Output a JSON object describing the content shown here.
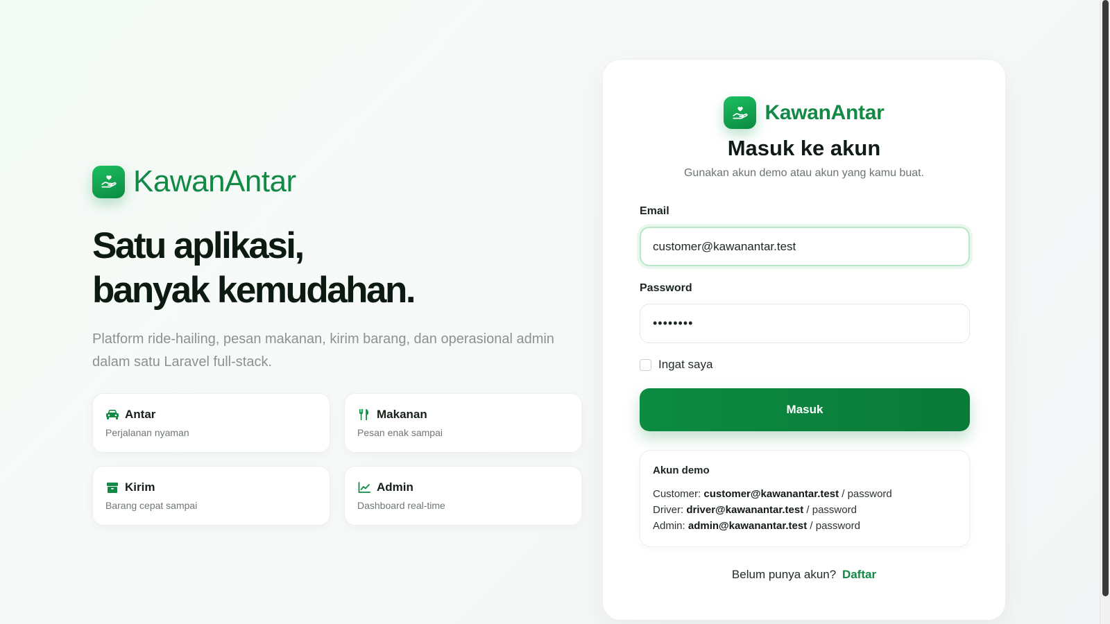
{
  "brand": {
    "name": "KawanAntar",
    "accent": "#128a46",
    "logo_icon": "hand-heart-icon"
  },
  "hero": {
    "headline_line1": "Satu aplikasi,",
    "headline_line2": "banyak kemudahan.",
    "lead": "Platform ride-hailing, pesan makanan, kirim barang, dan operasional admin dalam satu Laravel full-stack.",
    "features": [
      {
        "icon": "car-icon",
        "title": "Antar",
        "subtitle": "Perjalanan nyaman"
      },
      {
        "icon": "utensils-icon",
        "title": "Makanan",
        "subtitle": "Pesan enak sampai"
      },
      {
        "icon": "box-icon",
        "title": "Kirim",
        "subtitle": "Barang cepat sampai"
      },
      {
        "icon": "chart-line-icon",
        "title": "Admin",
        "subtitle": "Dashboard real-time"
      }
    ]
  },
  "login": {
    "title": "Masuk ke akun",
    "subtitle": "Gunakan akun demo atau akun yang kamu buat.",
    "email_label": "Email",
    "email_value": "customer@kawanantar.test",
    "password_label": "Password",
    "password_masked": "••••••••",
    "remember_label": "Ingat saya",
    "remember_checked": false,
    "submit_label": "Masuk",
    "demo": {
      "title": "Akun demo",
      "rows": [
        {
          "role": "Customer:",
          "email": "customer@kawanantar.test",
          "password": "/ password"
        },
        {
          "role": "Driver:",
          "email": "driver@kawanantar.test",
          "password": "/ password"
        },
        {
          "role": "Admin:",
          "email": "admin@kawanantar.test",
          "password": "/ password"
        }
      ]
    },
    "signup_prompt": "Belum punya akun?",
    "signup_link": "Daftar"
  }
}
